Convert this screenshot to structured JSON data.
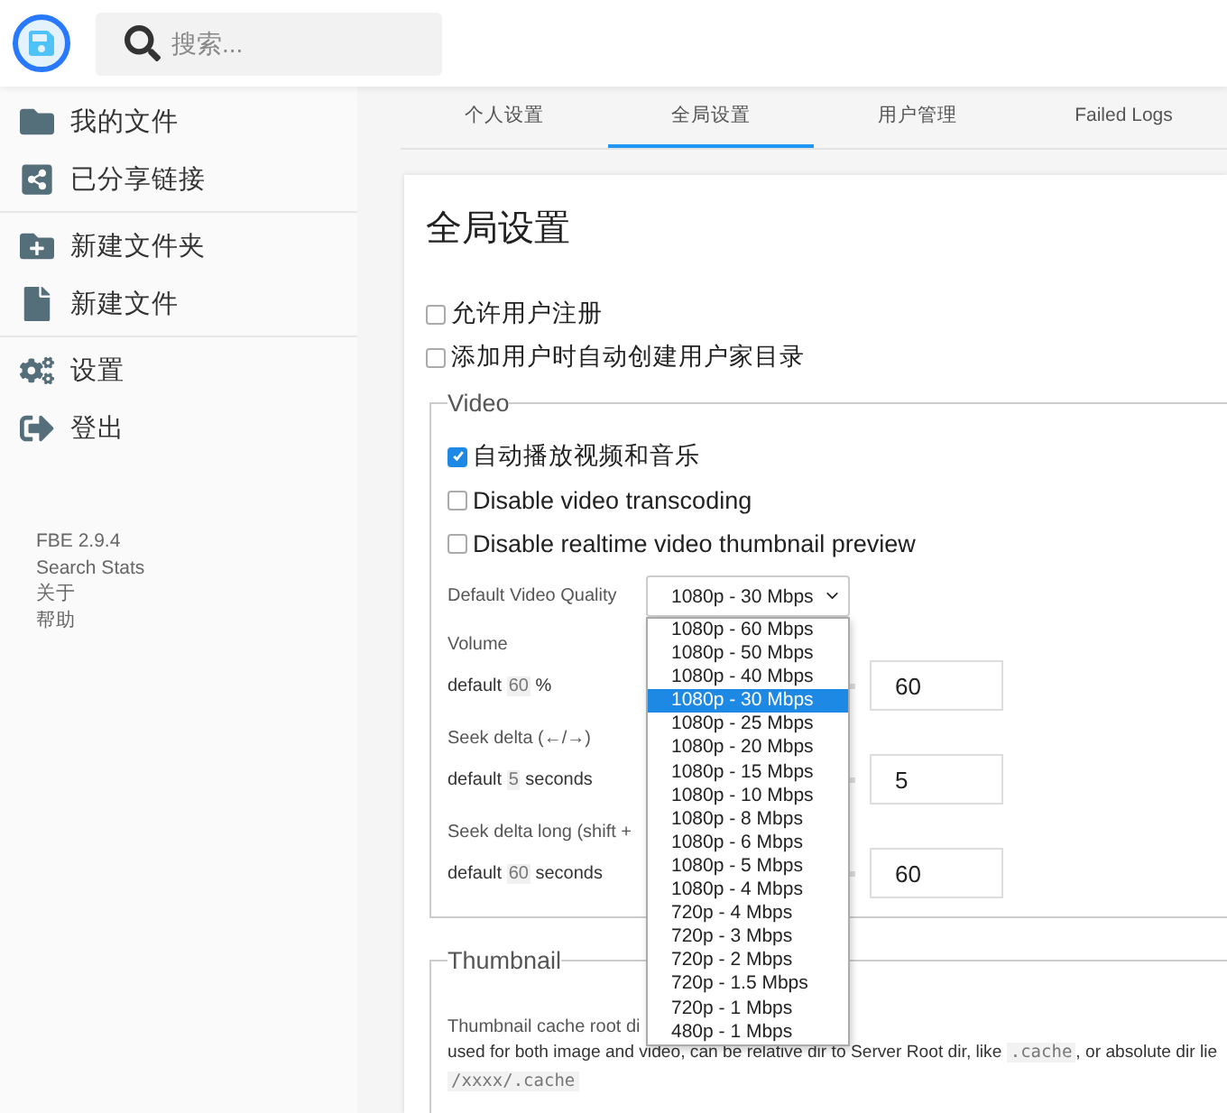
{
  "header": {
    "search": {
      "placeholder": "搜索..."
    }
  },
  "sidebar": {
    "groups": [
      [
        {
          "label": "我的文件"
        },
        {
          "label": "已分享链接"
        }
      ],
      [
        {
          "label": "新建文件夹"
        },
        {
          "label": "新建文件"
        }
      ],
      [
        {
          "label": "设置"
        },
        {
          "label": "登出"
        }
      ]
    ],
    "footer": [
      "FBE 2.9.4",
      "Search Stats",
      "关于",
      "帮助"
    ]
  },
  "tabs": [
    {
      "label": "个人设置",
      "selected": false
    },
    {
      "label": "全局设置",
      "selected": true
    },
    {
      "label": "用户管理",
      "selected": false
    },
    {
      "label": "Failed Logs",
      "selected": false
    }
  ],
  "page": {
    "title": "全局设置",
    "options": [
      {
        "label": "允许用户注册",
        "checked": false
      },
      {
        "label": "添加用户时自动创建用户家目录",
        "checked": false
      }
    ],
    "video": {
      "legend": "Video",
      "options": [
        {
          "label": "自动播放视频和音乐",
          "checked": true
        },
        {
          "label": "Disable video transcoding",
          "checked": false
        },
        {
          "label": "Disable realtime video thumbnail preview",
          "checked": false
        }
      ],
      "quality": {
        "label": "Default Video Quality",
        "value": "1080p - 30 Mbps",
        "options": [
          {
            "label": "1080p - 60 Mbps",
            "selected": false
          },
          {
            "label": "1080p - 50 Mbps",
            "selected": false
          },
          {
            "label": "1080p - 40 Mbps",
            "selected": false
          },
          {
            "label": "1080p - 30 Mbps",
            "selected": true
          },
          {
            "label": "1080p - 25 Mbps",
            "selected": false
          },
          {
            "label": "1080p - 20 Mbps",
            "selected": false
          },
          {
            "label": "1080p - 15 Mbps",
            "selected": false
          },
          {
            "label": "1080p - 10 Mbps",
            "selected": false
          },
          {
            "label": "1080p - 8 Mbps",
            "selected": false
          },
          {
            "label": "1080p - 6 Mbps",
            "selected": false
          },
          {
            "label": "1080p - 5 Mbps",
            "selected": false
          },
          {
            "label": "1080p - 4 Mbps",
            "selected": false
          },
          {
            "label": "720p - 4 Mbps",
            "selected": false
          },
          {
            "label": "720p - 3 Mbps",
            "selected": false
          },
          {
            "label": "720p - 2 Mbps",
            "selected": false
          },
          {
            "label": "720p - 1.5 Mbps",
            "selected": false
          },
          {
            "label": "720p - 1 Mbps",
            "selected": false
          },
          {
            "label": "480p - 1 Mbps",
            "selected": false
          }
        ]
      },
      "sliders": [
        {
          "label": "Volume",
          "before": "default",
          "default": "60",
          "after": "%",
          "value": "60"
        },
        {
          "label": "Seek delta (←/→)",
          "before": "default",
          "default": "5",
          "after": "seconds",
          "value": "5"
        },
        {
          "label": "Seek delta long (shift +",
          "before": "default",
          "default": "60",
          "after": "seconds",
          "value": "60"
        }
      ]
    },
    "thumbnail": {
      "legend": "Thumbnail",
      "label": "Thumbnail cache root di",
      "description": [
        {
          "kind": "text",
          "text": "used for both image and video, can be relative dir to Server Root dir, like"
        },
        {
          "kind": "code",
          "text": ".cache"
        },
        {
          "kind": "text",
          "text": ", or absolute dir lie"
        },
        {
          "kind": "code",
          "text": "/xxxx/.cache"
        }
      ]
    }
  }
}
